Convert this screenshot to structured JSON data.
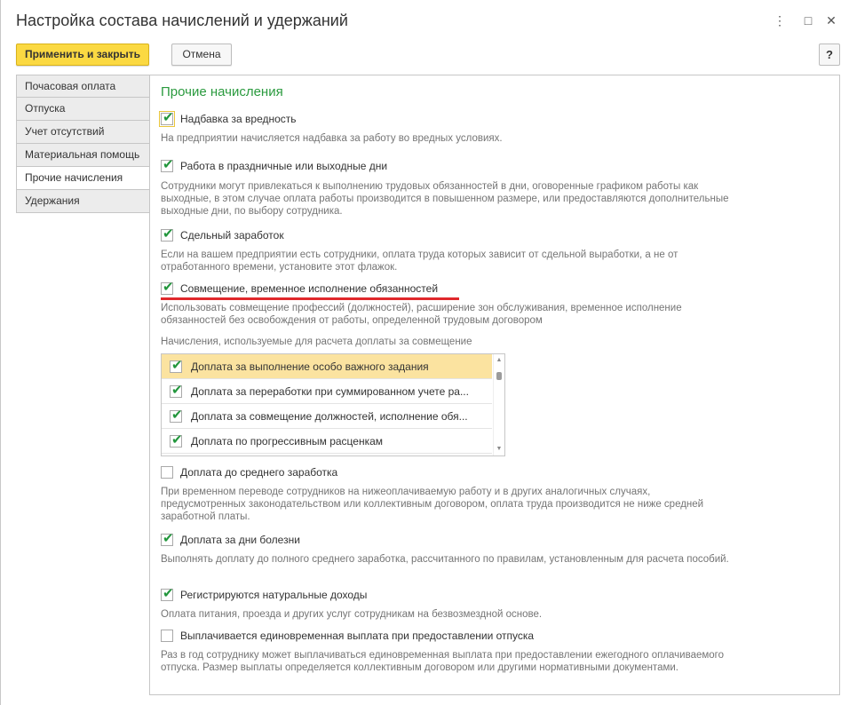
{
  "window": {
    "title": "Настройка состава начислений и удержаний",
    "controls": {
      "menu": "⋮",
      "maximize": "□",
      "close": "✕"
    }
  },
  "toolbar": {
    "apply_close_label": "Применить и закрыть",
    "cancel_label": "Отмена",
    "help_label": "?"
  },
  "sidebar": {
    "items": [
      {
        "label": "Почасовая оплата"
      },
      {
        "label": "Отпуска"
      },
      {
        "label": "Учет отсутствий"
      },
      {
        "label": "Материальная помощь"
      },
      {
        "label": "Прочие начисления",
        "active": true
      },
      {
        "label": "Удержания"
      }
    ]
  },
  "main": {
    "section_title": "Прочие начисления",
    "options": [
      {
        "label": "Надбавка за вредность",
        "checked": true,
        "desc": "На предприятии начисляется надбавка за работу во вредных условиях."
      },
      {
        "label": "Работа в праздничные или выходные дни",
        "checked": true,
        "desc": "Сотрудники могут привлекаться к выполнению трудовых обязанностей в дни, оговоренные графиком работы как выходные, в этом случае оплата работы производится в повышенном размере, или предоставляются дополнительные выходные дни, по выбору сотрудника."
      },
      {
        "label": "Сдельный заработок",
        "checked": true,
        "desc": "Если на вашем предприятии есть сотрудники, оплата труда которых зависит от сдельной выработки, а не от отработанного времени, установите этот флажок."
      },
      {
        "label": "Совмещение, временное исполнение обязанностей",
        "checked": true,
        "desc": "Использовать совмещение профессий (должностей), расширение зон обслуживания, временное исполнение обязанностей без освобождения от работы, определенной трудовым договором"
      },
      {
        "label": "Доплата до среднего заработка",
        "checked": false,
        "desc": "При временном переводе сотрудников на нижеоплачиваемую работу и в других аналогичных случаях, предусмотренных законодательством или коллективным договором, оплата труда производится не ниже средней заработной платы."
      },
      {
        "label": "Доплата за дни болезни",
        "checked": true,
        "desc": "Выполнять доплату до полного среднего заработка, рассчитанного по правилам, установленным для расчета пособий."
      },
      {
        "label": "Регистрируются натуральные доходы",
        "checked": true,
        "desc": "Оплата питания, проезда и других услуг сотрудникам на безвозмездной основе."
      },
      {
        "label": "Выплачивается единовременная выплата при предоставлении отпуска",
        "checked": false,
        "desc": "Раз в год сотруднику может выплачиваться единовременная выплата при предоставлении ежегодного оплачиваемого отпуска. Размер выплаты определяется коллективным договором или другими нормативными документами."
      }
    ],
    "combination_list": {
      "caption": "Начисления, используемые для расчета доплаты за совмещение",
      "rows": [
        {
          "label": "Доплата за выполнение особо важного задания",
          "checked": true
        },
        {
          "label": "Доплата за переработки при суммированном учете ра...",
          "checked": true
        },
        {
          "label": "Доплата за совмещение должностей, исполнение обя...",
          "checked": true
        },
        {
          "label": "Доплата по прогрессивным расценкам",
          "checked": true
        }
      ]
    }
  },
  "check_mark": "✔",
  "colors": {
    "accent_green": "#2a9a3e",
    "primary_button": "#fbd942",
    "selected_row": "#fbe3a0",
    "highlight_underline": "#e0282c"
  }
}
